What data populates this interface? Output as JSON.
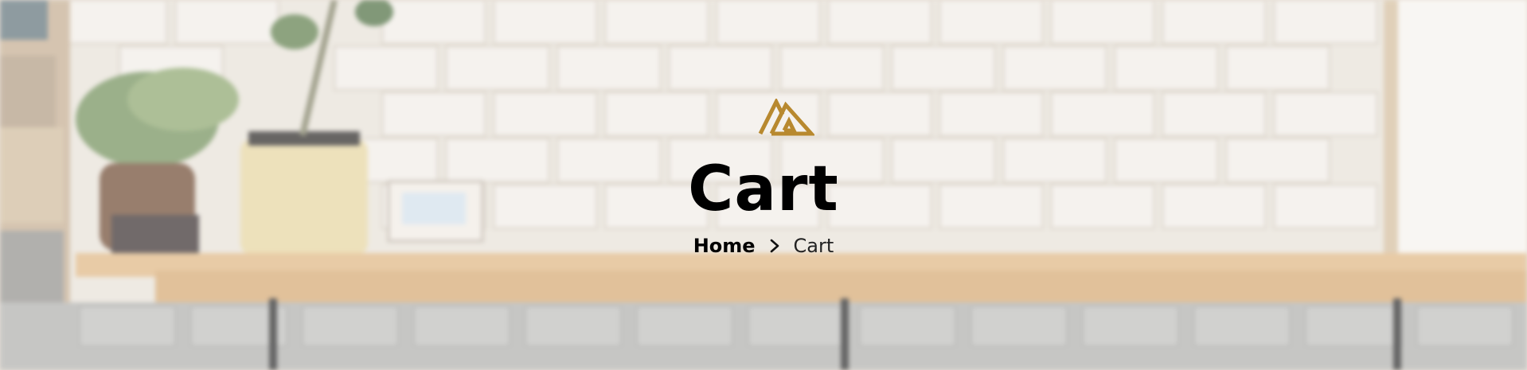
{
  "page": {
    "title": "Cart"
  },
  "breadcrumb": {
    "home_label": "Home",
    "separator_icon": "chevron-right-icon",
    "current_label": "Cart"
  },
  "logo": {
    "icon": "brand-logo-icon",
    "color": "#b8892f"
  },
  "colors": {
    "title": "#000000",
    "brand_gold": "#b8892f"
  }
}
